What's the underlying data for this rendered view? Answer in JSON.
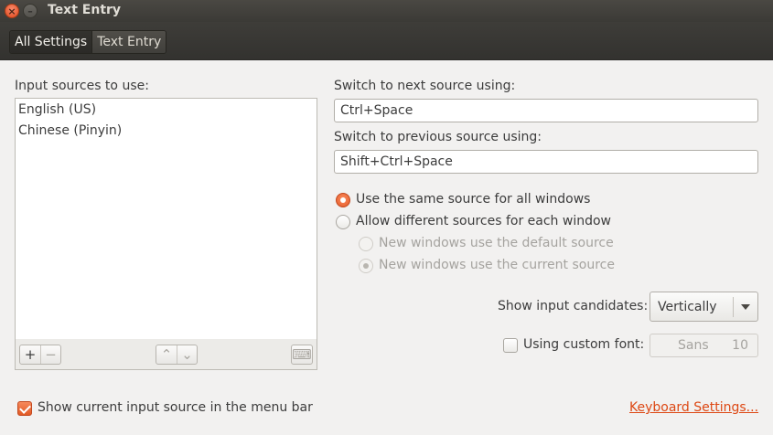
{
  "window": {
    "title": "Text Entry",
    "close_glyph": "×",
    "minimize_glyph": "–"
  },
  "breadcrumb": {
    "items": [
      "All Settings",
      "Text Entry"
    ]
  },
  "input_sources": {
    "label": "Input sources to use:",
    "items": [
      "English (US)",
      "Chinese (Pinyin)"
    ],
    "add_glyph": "+",
    "remove_glyph": "−",
    "up_glyph": "⌃",
    "down_glyph": "⌄",
    "keyboard_glyph": "⌨"
  },
  "next_source": {
    "label": "Switch to next source using:",
    "value": "Ctrl+Space"
  },
  "previous_source": {
    "label": "Switch to previous source using:",
    "value": "Shift+Ctrl+Space"
  },
  "source_mode": {
    "same_label": "Use the same source for all windows",
    "different_label": "Allow different sources for each window",
    "new_default_label": "New windows use the default source",
    "new_current_label": "New windows use the current source",
    "selected": "same"
  },
  "candidates": {
    "label": "Show input candidates:",
    "value": "Vertically"
  },
  "custom_font": {
    "label": "Using custom font:",
    "checked": false,
    "font_name": "Sans",
    "font_size": "10"
  },
  "menu_bar": {
    "label": "Show current input source in the menu bar",
    "checked": true
  },
  "keyboard_settings_link": "Keyboard Settings...",
  "colors": {
    "accent": "#dd4814",
    "titlebar": "#3b3a36",
    "window_bg": "#f2f1f0"
  }
}
